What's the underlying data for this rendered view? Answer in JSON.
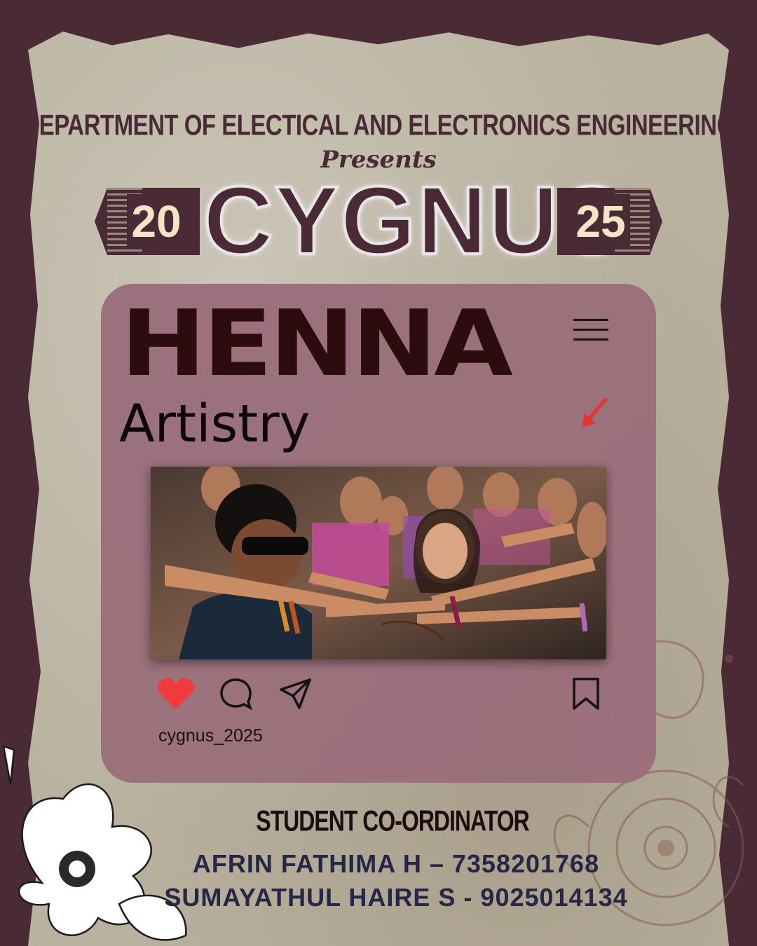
{
  "header": {
    "department": "DEPARTMENT OF ELECTICAL AND ELECTRONICS ENGINEERING",
    "presents": "Presents",
    "event_name": "CYGNUS",
    "year_left": "20",
    "year_right": "25"
  },
  "post_card": {
    "title": "HENNA",
    "subtitle": "Artistry",
    "username": "cygnus_2025",
    "icons": [
      "menu-icon",
      "arrow-icon",
      "heart-icon",
      "comment-icon",
      "share-icon",
      "bookmark-icon"
    ]
  },
  "coordinators": {
    "heading": "STUDENT CO-ORDINATOR",
    "people": [
      "AFRIN FATHIMA H – 7358201768",
      "SUMAYATHUL HAIRE S - 9025014134"
    ]
  },
  "colors": {
    "frame": "#4a2b35",
    "paper": "#b9b29f",
    "card": "#9a6e7b",
    "title": "#2d0c10",
    "heart": "#ef3b3b",
    "arrow": "#e8322f",
    "coordinator_text": "#262646"
  }
}
